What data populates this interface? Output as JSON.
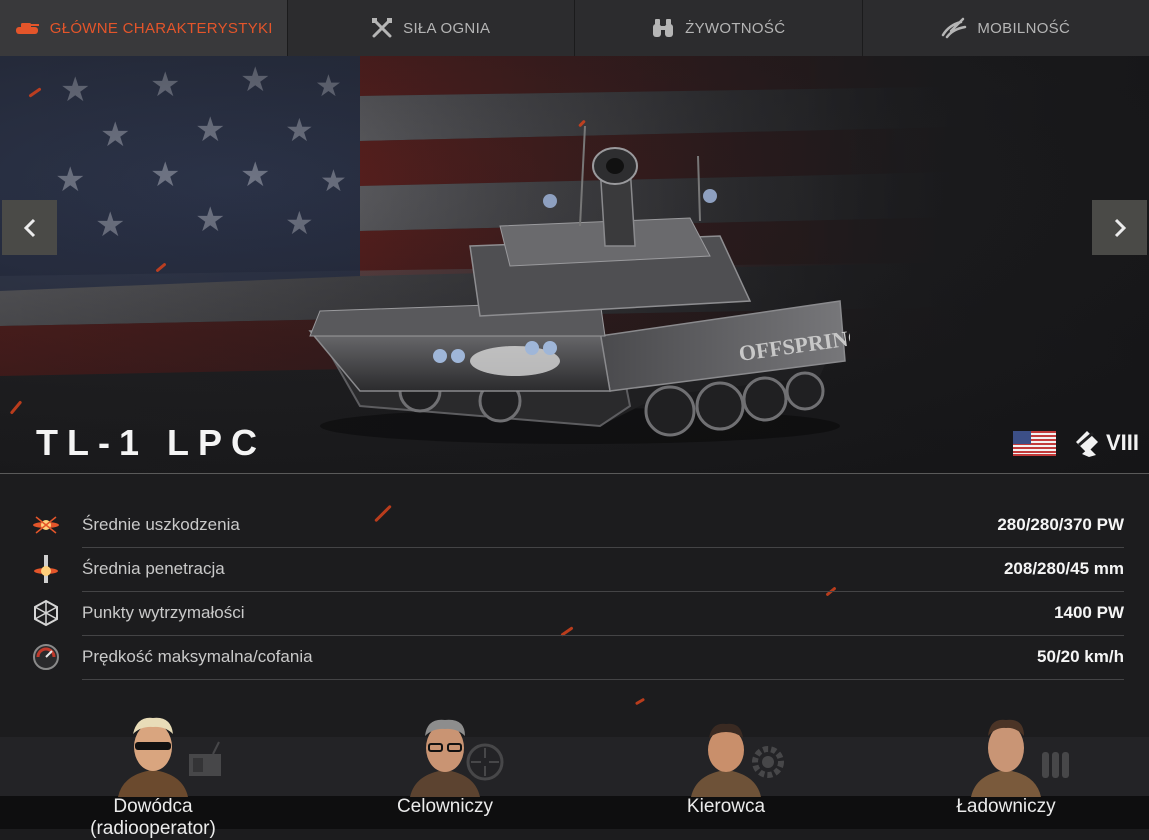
{
  "tabs": [
    {
      "label": "GŁÓWNE CHARAKTERYSTYKI",
      "icon": "tank-icon",
      "active": true
    },
    {
      "label": "SIŁA OGNIA",
      "icon": "crossed-guns-icon",
      "active": false
    },
    {
      "label": "ŻYWOTNOŚĆ",
      "icon": "binoculars-icon",
      "active": false
    },
    {
      "label": "MOBILNOŚĆ",
      "icon": "speed-lines-icon",
      "active": false
    }
  ],
  "vehicle": {
    "name": "TL-1 LPC",
    "nation_flag": "usa-flag-icon",
    "tier": "VIII",
    "tier_icon": "light-tank-class-icon"
  },
  "stats": [
    {
      "label": "Średnie uszkodzenia",
      "value": "280/280/370 PW",
      "icon": "damage-burst-icon"
    },
    {
      "label": "Średnia penetracja",
      "value": "208/280/45 mm",
      "icon": "penetration-icon"
    },
    {
      "label": "Punkty wytrzymałości",
      "value": "1400 PW",
      "icon": "hit-points-icon"
    },
    {
      "label": "Prędkość maksymalna/cofania",
      "value": "50/20 km/h",
      "icon": "speedometer-icon"
    }
  ],
  "crew": [
    {
      "label": "Dowódca (radiooperator)",
      "role_icon": "radio-icon"
    },
    {
      "label": "Celowniczy",
      "role_icon": "crosshair-icon"
    },
    {
      "label": "Kierowca",
      "role_icon": "gear-icon"
    },
    {
      "label": "Ładowniczy",
      "role_icon": "shells-icon"
    }
  ],
  "colors": {
    "accent": "#e4552a",
    "tab_bg": "#2c2c2e",
    "tab_active_bg": "#39393b",
    "page_bg": "#1c1c1e"
  }
}
